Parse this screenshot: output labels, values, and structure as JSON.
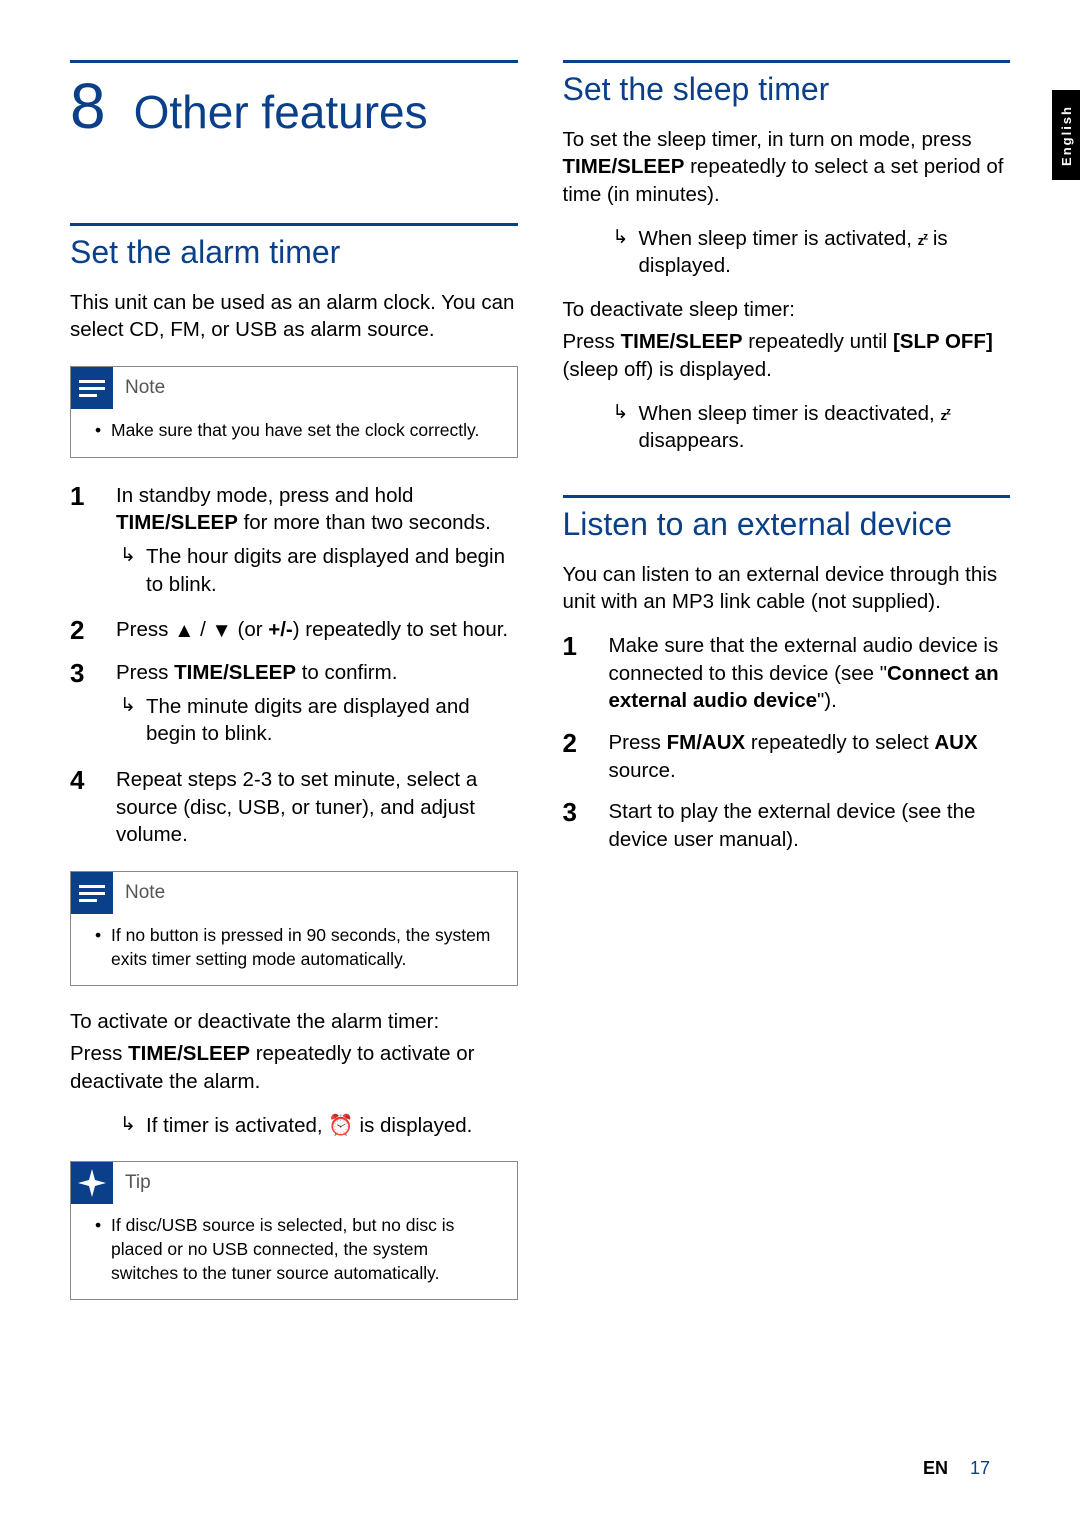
{
  "side_tab": "English",
  "chapter": {
    "num": "8",
    "title": "Other features"
  },
  "left": {
    "sec1": {
      "title": "Set the alarm timer",
      "intro": "This unit can be used as an alarm clock. You can select CD, FM, or USB as alarm source.",
      "note_label": "Note",
      "note_item": "Make sure that you have set the clock correctly.",
      "step1_a": "In standby mode, press and hold ",
      "step1_b": "TIME/SLEEP",
      "step1_c": " for more than two seconds.",
      "step1_sub": "The hour digits are displayed and begin to blink.",
      "step2_a": "Press ",
      "step2_b": " (or ",
      "step2_c": "+/-",
      "step2_d": ") repeatedly to set hour.",
      "step3_a": "Press ",
      "step3_b": "TIME/SLEEP",
      "step3_c": " to confirm.",
      "step3_sub": "The minute digits are displayed and begin to blink.",
      "step4": "Repeat steps 2-3 to set minute, select a source (disc, USB, or tuner), and adjust volume.",
      "note2_label": "Note",
      "note2_item": "If no button is pressed in 90 seconds, the system exits timer setting mode automatically.",
      "subhead": "To activate or deactivate the alarm timer:",
      "act_a": "Press ",
      "act_b": "TIME/SLEEP",
      "act_c": " repeatedly to activate or deactivate the alarm.",
      "act_sub_a": "If timer is activated, ",
      "act_sub_b": " is displayed.",
      "tip_label": "Tip",
      "tip_item": "If disc/USB source is selected, but no disc is placed or no USB connected, the system switches to the tuner source automatically."
    }
  },
  "right": {
    "sec1": {
      "title": "Set the sleep timer",
      "intro_a": "To set the sleep timer, in turn on mode, press ",
      "intro_b": "TIME/SLEEP",
      "intro_c": " repeatedly to select a set period of time (in minutes).",
      "sub1_a": "When sleep timer is activated, ",
      "sub1_b": " is displayed.",
      "subhead": "To deactivate sleep timer:",
      "deact_a": "Press ",
      "deact_b": "TIME/SLEEP",
      "deact_c": " repeatedly until ",
      "deact_d": "[SLP OFF]",
      "deact_e": " (sleep off) is displayed.",
      "sub2_a": "When sleep timer is deactivated, ",
      "sub2_b": " disappears."
    },
    "sec2": {
      "title": "Listen to an external device",
      "intro": "You can listen to an external device through this unit with an MP3 link cable (not supplied).",
      "step1_a": "Make sure that the external audio device is connected to this device (see \"",
      "step1_b": "Connect an external audio device",
      "step1_c": "\").",
      "step2_a": "Press ",
      "step2_b": "FM/AUX",
      "step2_c": " repeatedly to select ",
      "step2_d": "AUX",
      "step2_e": " source.",
      "step3": "Start to play the external device (see the device user manual)."
    }
  },
  "footer": {
    "lang": "EN",
    "page": "17"
  }
}
